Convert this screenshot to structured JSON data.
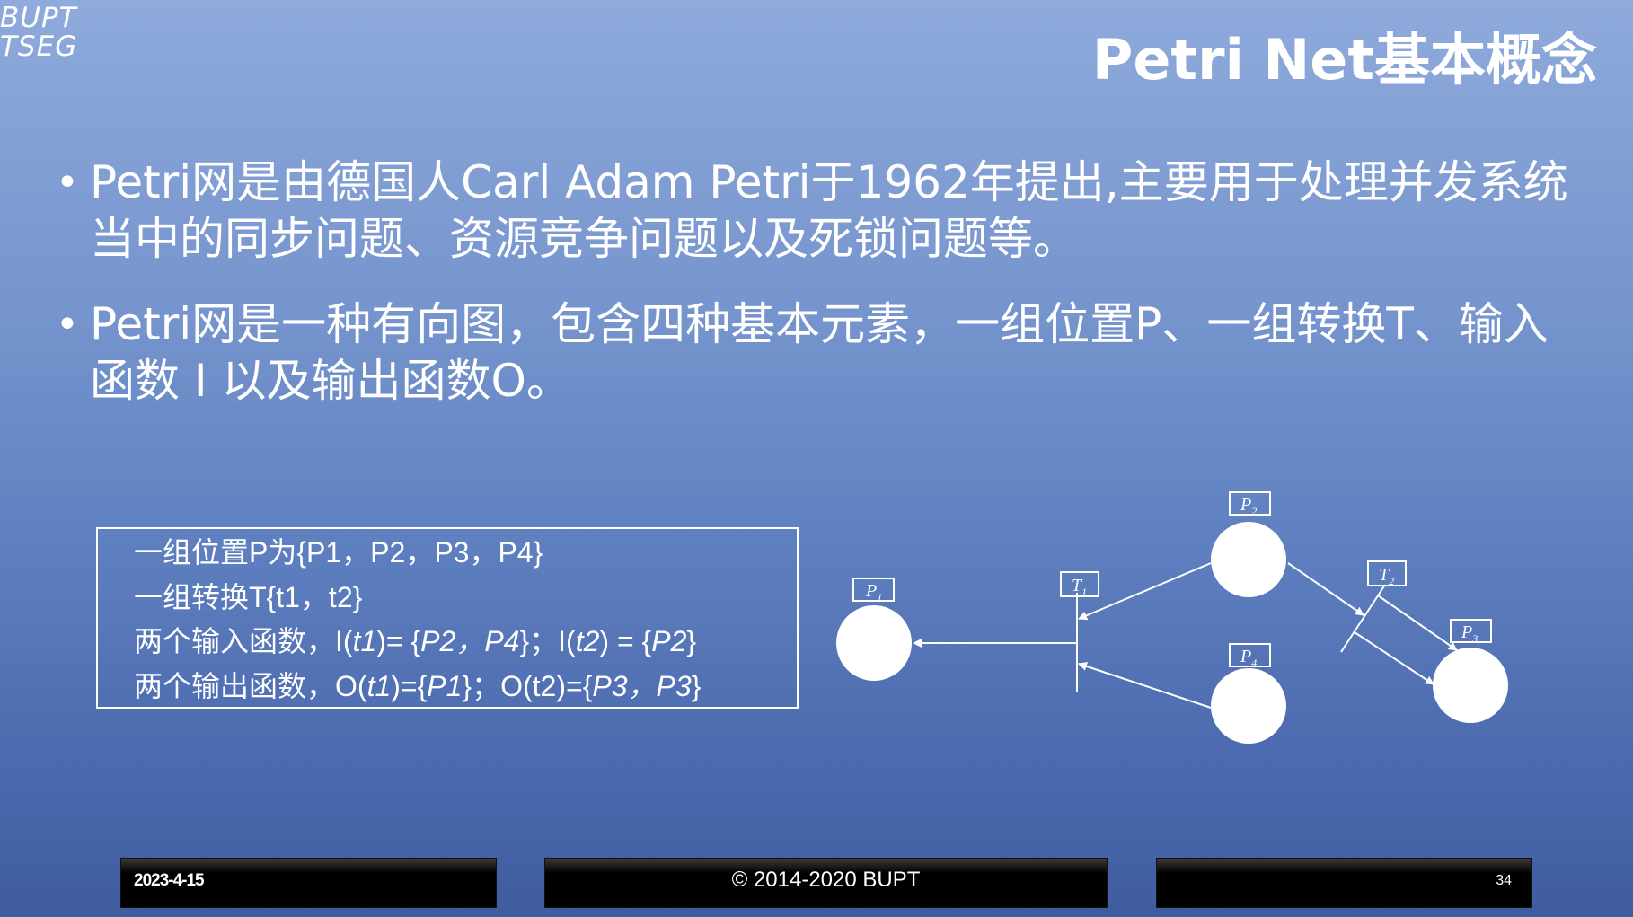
{
  "logo": {
    "line1": "BUPT",
    "line2": "TSEG"
  },
  "title": "Petri Net基本概念",
  "bullets": [
    {
      "marker": "•",
      "text": "Petri网是由德国人Carl Adam Petri于1962年提出,主要用于处理并发系统当中的同步问题、资源竞争问题以及死锁问题等。"
    },
    {
      "marker": "•",
      "text": "Petri网是一种有向图，包含四种基本元素，一组位置P、一组转换T、输入函数 I 以及输出函数O。"
    }
  ],
  "definitions": {
    "line1": "一组位置P为{P1，P2，P3，P4}",
    "line2": "一组转换T{t1，t2}",
    "line3": {
      "pre": "两个输入函数，I(",
      "a": "t1",
      "b": ")= {",
      "c": "P2，P4",
      "d": "}；I(",
      "e": "t2",
      "f": ") = {",
      "g": "P2",
      "h": "}"
    },
    "line4": {
      "pre": "两个输出函数，O(",
      "a": "t1",
      "b": ")={",
      "c": "P1",
      "d": "}；O(t2)={",
      "e": "P3，P3",
      "f": "}"
    }
  },
  "diagram": {
    "places": {
      "p1": "P",
      "p2": "P",
      "p3": "P",
      "p4": "P"
    },
    "place_subs": {
      "p1": "1",
      "p2": "2",
      "p3": "3",
      "p4": "4"
    },
    "transitions": {
      "t1": "T",
      "t2": "T"
    },
    "transition_subs": {
      "t1": "1",
      "t2": "2"
    }
  },
  "footer": {
    "date": "2023-4-15",
    "copyright": "© 2014-2020 BUPT",
    "page": "34"
  }
}
